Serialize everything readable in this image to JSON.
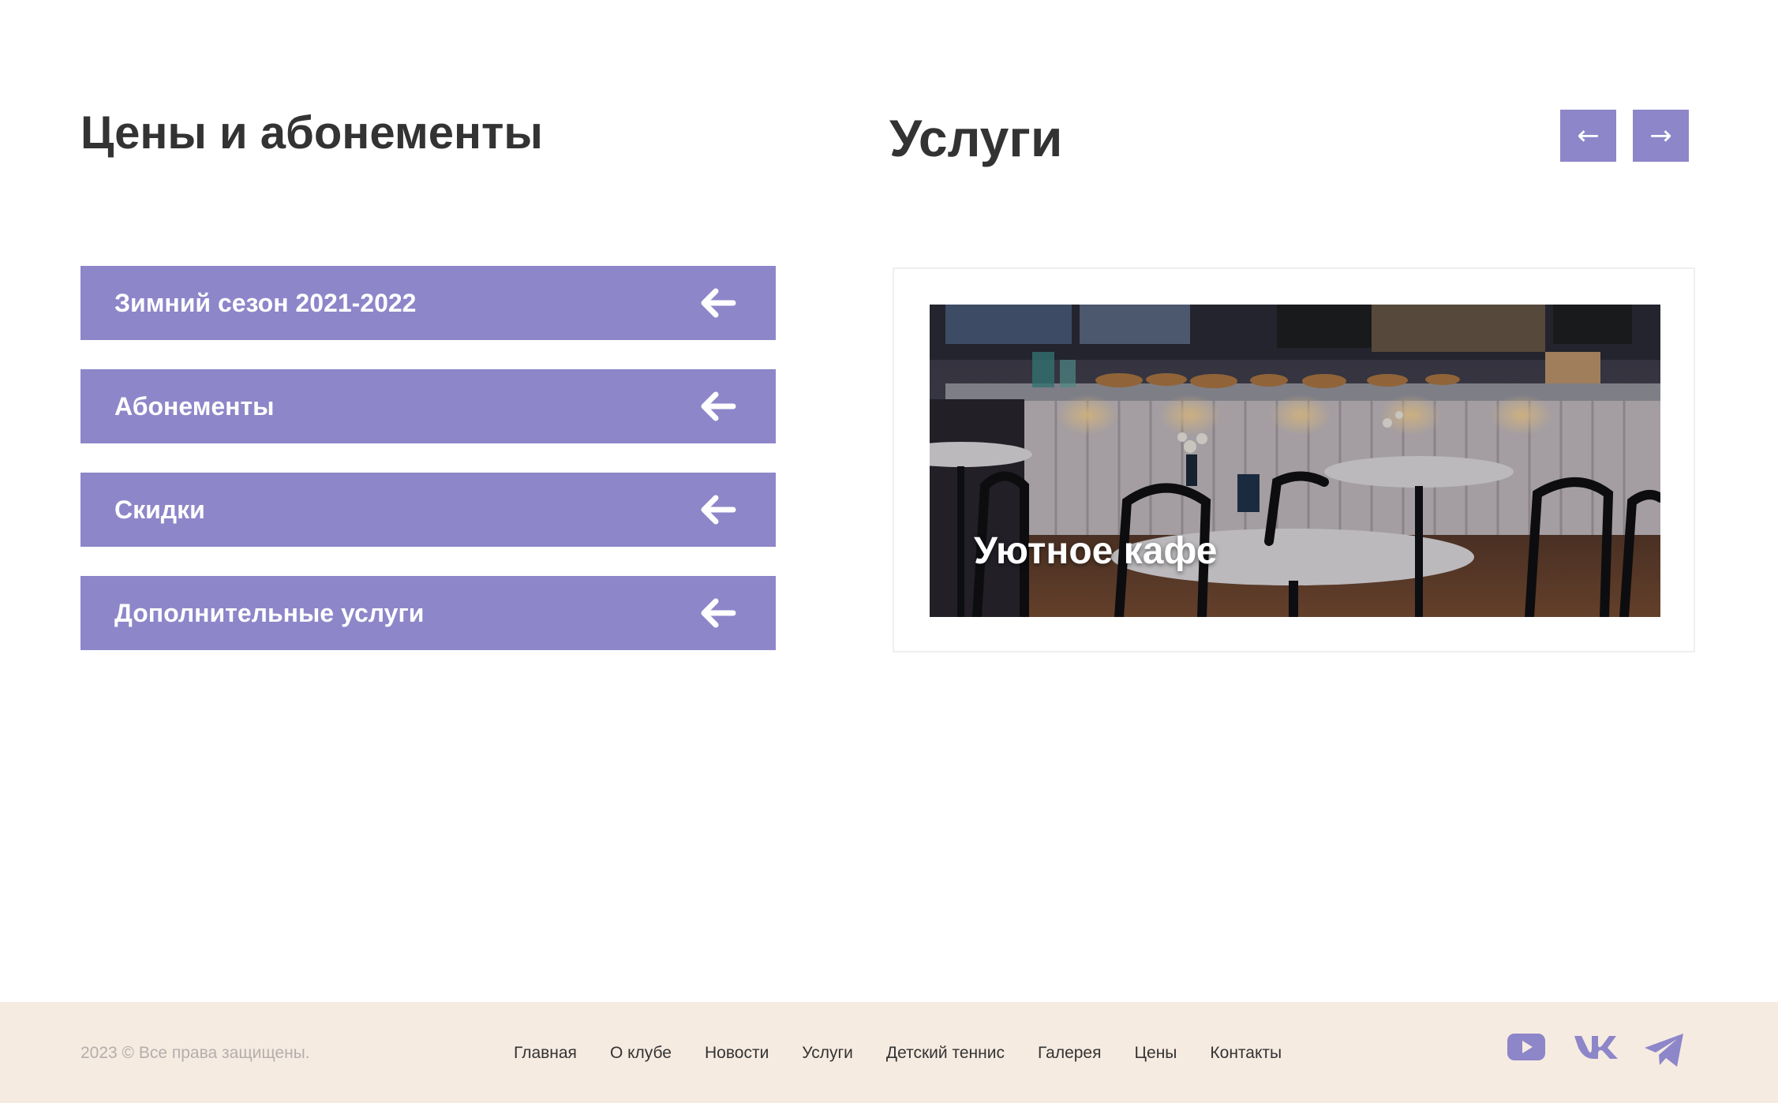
{
  "prices": {
    "title": "Цены и абонементы",
    "items": [
      {
        "label": "Зимний сезон 2021-2022"
      },
      {
        "label": "Абонементы"
      },
      {
        "label": "Скидки"
      },
      {
        "label": "Дополнительные услуги"
      }
    ]
  },
  "services": {
    "title": "Услуги",
    "prev_label": "←",
    "next_label": "→",
    "cards": [
      {
        "caption": "Уютное кафе",
        "image": "cafe-interior-photo"
      }
    ]
  },
  "footer": {
    "copyright": "2023 © Все права защищены.",
    "nav": [
      {
        "label": "Главная"
      },
      {
        "label": "О клубе"
      },
      {
        "label": "Новости"
      },
      {
        "label": "Услуги"
      },
      {
        "label": "Детский теннис"
      },
      {
        "label": "Галерея"
      },
      {
        "label": "Цены"
      },
      {
        "label": "Контакты"
      }
    ],
    "socials": [
      "youtube-icon",
      "vk-icon",
      "telegram-icon"
    ]
  },
  "colors": {
    "accent": "#8d86c9",
    "footer_bg": "#f6ebe1",
    "text": "#333333",
    "muted": "#b4aeab"
  }
}
